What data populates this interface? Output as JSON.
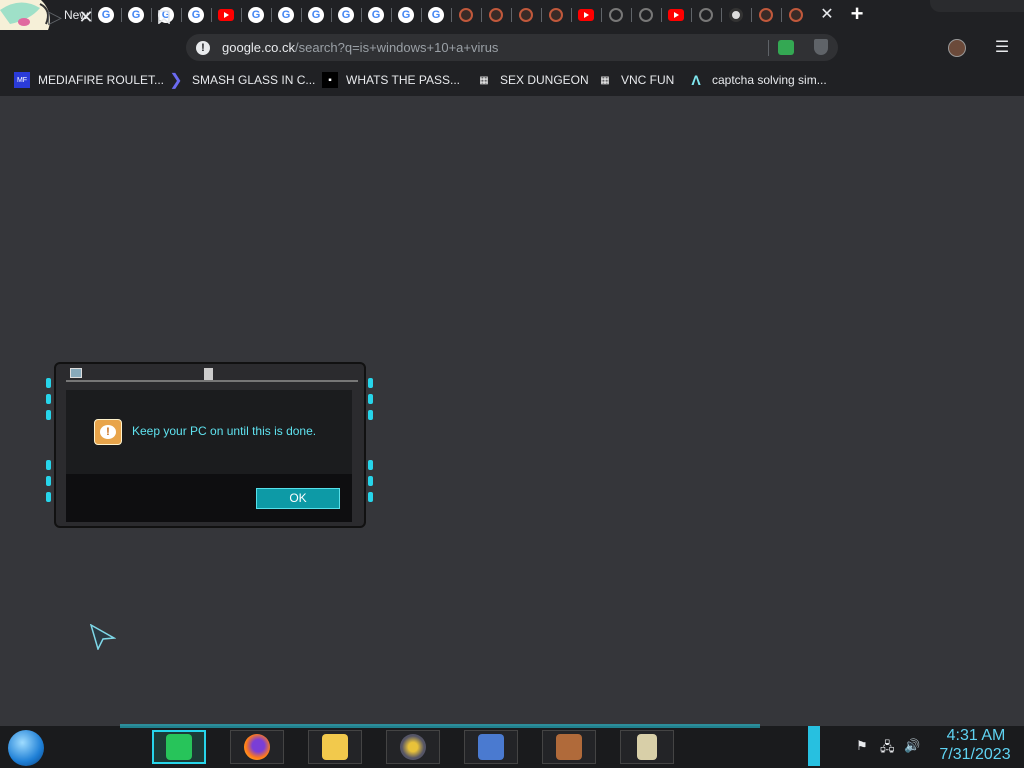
{
  "browser": {
    "first_tab_label": "New",
    "tab_icons": [
      "google-icon",
      "google-icon",
      "google-icon",
      "google-icon",
      "youtube-icon",
      "google-icon",
      "google-icon",
      "google-icon",
      "google-icon",
      "google-icon",
      "google-icon",
      "google-icon",
      "spiral-icon",
      "spiral-icon",
      "spiral-icon",
      "spiral-icon",
      "youtube-icon",
      "gray-spiral-icon",
      "gray-spiral-icon",
      "youtube-icon",
      "gray-spiral-icon",
      "camera-icon",
      "spiral-icon",
      "spiral-icon"
    ],
    "close_tab_symbol": "✕",
    "new_tab_symbol": "+",
    "address": {
      "host": "google.co.ck",
      "path": "/search?q=is+windows+10+a+virus"
    },
    "bookmarks": [
      {
        "label": "MEDIAFIRE ROULET...",
        "icon": "mediafire-icon"
      },
      {
        "label": "SMASH GLASS IN C...",
        "icon": "chevron-icon"
      },
      {
        "label": "WHATS THE PASS...",
        "icon": "lock-icon"
      },
      {
        "label": "SEX DUNGEON",
        "icon": "server-icon"
      },
      {
        "label": "VNC FUN",
        "icon": "server-icon"
      },
      {
        "label": "captcha solving sim...",
        "icon": "lambda-icon"
      }
    ]
  },
  "dialog": {
    "message": "Keep your PC on until this is done.",
    "ok_label": "OK",
    "warn_glyph": "!"
  },
  "taskbar": {
    "apps": [
      "chat-app",
      "firefox",
      "file-explorer",
      "media-disc",
      "network-computer",
      "minecraft-globe",
      "notebook"
    ],
    "clock_time": "4:31 AM",
    "clock_date": "7/31/2023"
  },
  "colors": {
    "accent": "#27d5ea",
    "dialog_text": "#5fe3f0",
    "ok_button": "#0d9aa6",
    "desktop": "#35363a"
  }
}
